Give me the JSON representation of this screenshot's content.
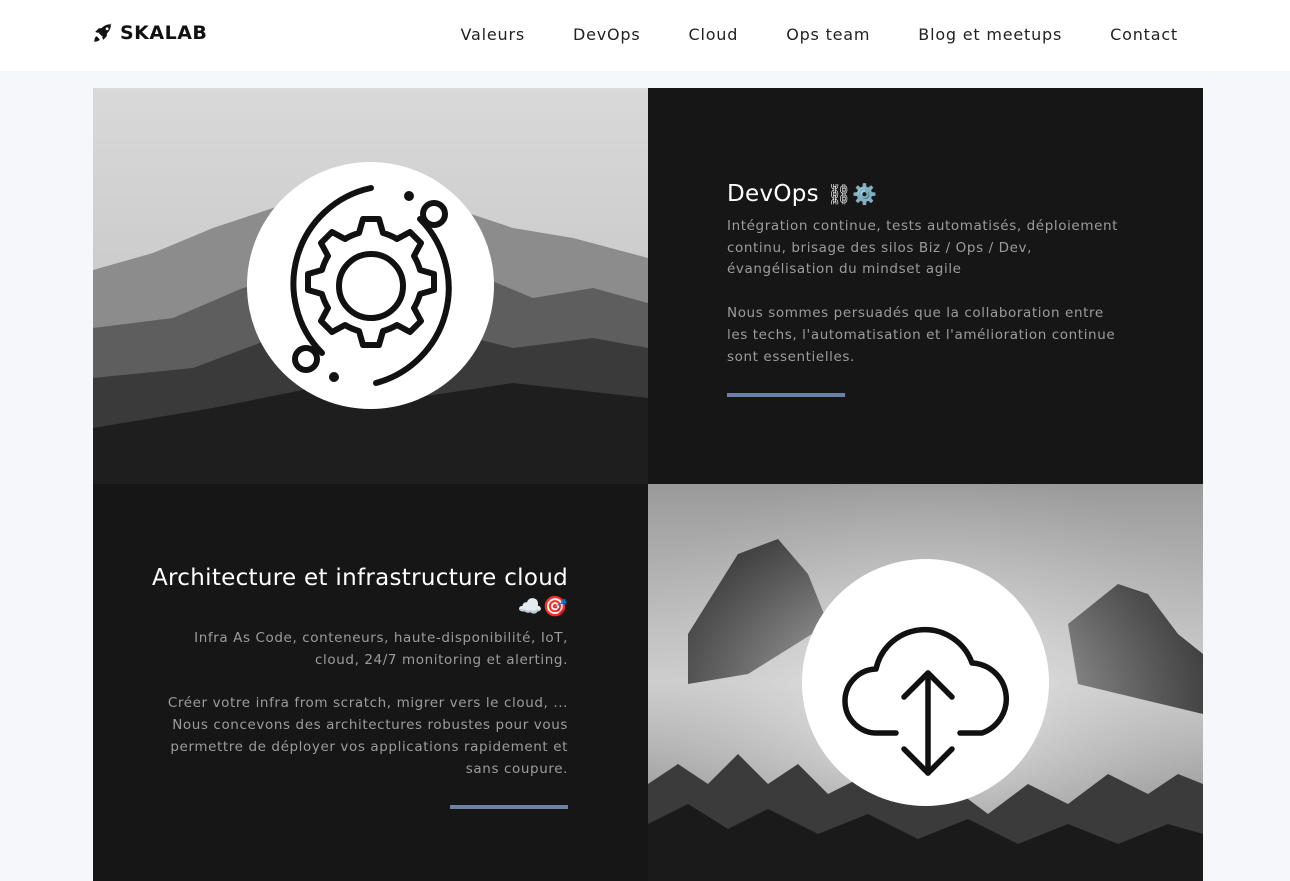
{
  "brand": {
    "name": "SKALAB",
    "icon": "rocket-icon"
  },
  "nav": {
    "items": [
      {
        "label": "Valeurs"
      },
      {
        "label": "DevOps"
      },
      {
        "label": "Cloud"
      },
      {
        "label": "Ops team"
      },
      {
        "label": "Blog et meetups"
      },
      {
        "label": "Contact"
      }
    ]
  },
  "devops": {
    "title": "DevOps",
    "title_emoji": "⛓⚙️",
    "desc1": "Intégration continue, tests automatisés, déploiement continu, brisage des silos Biz / Ops / Dev, évangélisation du mindset agile",
    "desc2": "Nous sommes persuadés que la collaboration entre les techs, l'automatisation et l'amélioration continue sont essentielles.",
    "icon": "gear-orbit-icon"
  },
  "cloud": {
    "title": "Architecture et infrastructure cloud",
    "title_emoji": "☁️🎯",
    "desc1": "Infra As Code, conteneurs, haute-disponibilité, IoT, cloud, 24/7 monitoring et alerting.",
    "desc2": "Créer votre infra from scratch, migrer vers le cloud, ... Nous concevons des architectures robustes pour vous permettre de déployer vos applications rapidement et sans coupure.",
    "icon": "cloud-transfer-icon"
  },
  "colors": {
    "accent_bar": "#6d80a8",
    "dark_panel": "#161616",
    "page_bg": "#f5f7fa"
  }
}
